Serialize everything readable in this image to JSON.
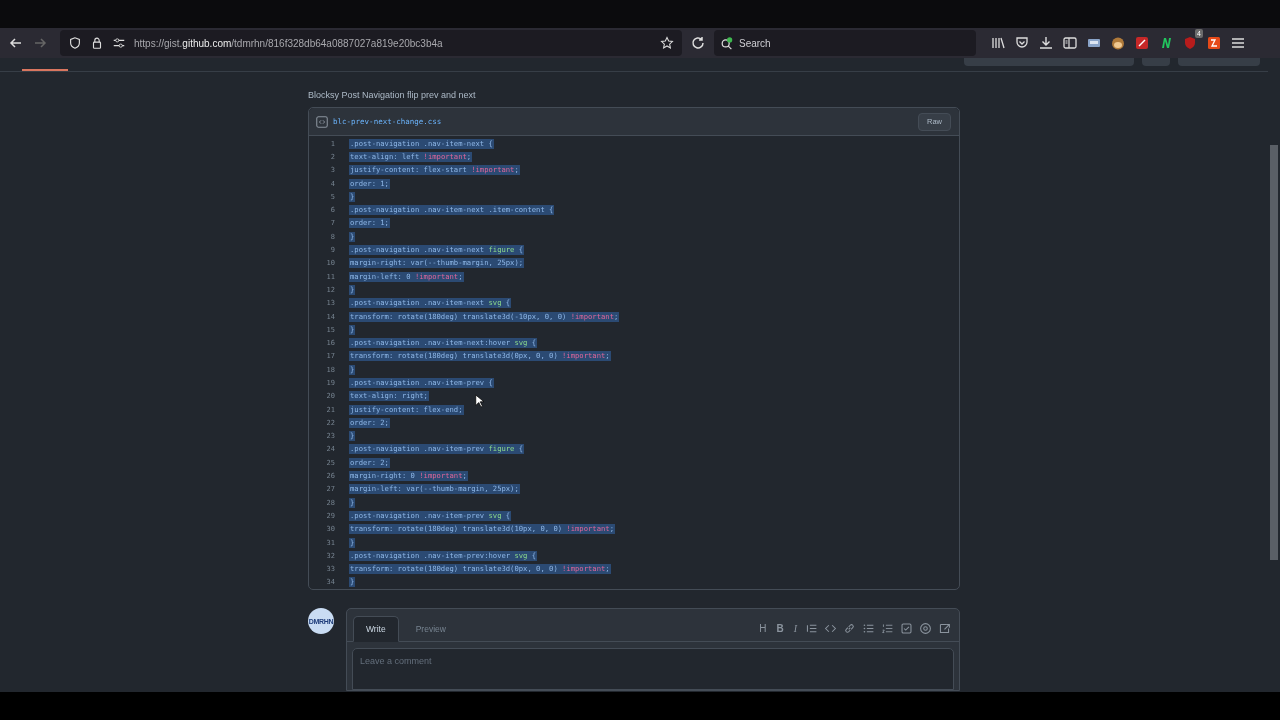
{
  "browser": {
    "url_prefix": "https://gist.",
    "url_domain": "github.com",
    "url_path": "/tdmrhn/816f328db64a0887027a819e20bc3b4a",
    "search_placeholder": "Search",
    "badge": "4"
  },
  "gist": {
    "description": "Blocksy Post Navigation flip prev and next",
    "file": {
      "name": "blc-prev-next-change.css",
      "raw_button": "Raw",
      "lines": [
        {
          "number": "1",
          "selected": true,
          "tokens": [
            {
              "text": ".post-navigation .nav-item-next {",
              "kind": "plain"
            }
          ]
        },
        {
          "number": "2",
          "selected": true,
          "tokens": [
            {
              "text": "text-align: left ",
              "kind": "plain"
            },
            {
              "text": "!important",
              "kind": "important"
            },
            {
              "text": ";",
              "kind": "plain"
            }
          ]
        },
        {
          "number": "3",
          "selected": true,
          "tokens": [
            {
              "text": "justify-content: flex-start ",
              "kind": "plain"
            },
            {
              "text": "!important",
              "kind": "important"
            },
            {
              "text": ";",
              "kind": "plain"
            }
          ]
        },
        {
          "number": "4",
          "selected": true,
          "tokens": [
            {
              "text": "order: 1;",
              "kind": "plain"
            }
          ]
        },
        {
          "number": "5",
          "selected": true,
          "tokens": [
            {
              "text": "}",
              "kind": "plain"
            }
          ]
        },
        {
          "number": "6",
          "selected": true,
          "tokens": [
            {
              "text": ".post-navigation .nav-item-next .item-content {",
              "kind": "plain"
            }
          ]
        },
        {
          "number": "7",
          "selected": true,
          "tokens": [
            {
              "text": "order: 1;",
              "kind": "plain"
            }
          ]
        },
        {
          "number": "8",
          "selected": true,
          "tokens": [
            {
              "text": "}",
              "kind": "plain"
            }
          ]
        },
        {
          "number": "9",
          "selected": true,
          "tokens": [
            {
              "text": ".post-navigation .nav-item-next ",
              "kind": "plain"
            },
            {
              "text": "figure",
              "kind": "tag"
            },
            {
              "text": " {",
              "kind": "plain"
            }
          ]
        },
        {
          "number": "10",
          "selected": true,
          "tokens": [
            {
              "text": "margin-right: var(--thumb-margin, 25px);",
              "kind": "plain"
            }
          ]
        },
        {
          "number": "11",
          "selected": true,
          "tokens": [
            {
              "text": "margin-left: 0 ",
              "kind": "plain"
            },
            {
              "text": "!important",
              "kind": "important"
            },
            {
              "text": ";",
              "kind": "plain"
            }
          ]
        },
        {
          "number": "12",
          "selected": true,
          "tokens": [
            {
              "text": "}",
              "kind": "plain"
            }
          ]
        },
        {
          "number": "13",
          "selected": true,
          "tokens": [
            {
              "text": ".post-navigation .nav-item-next ",
              "kind": "plain"
            },
            {
              "text": "svg",
              "kind": "tag"
            },
            {
              "text": " {",
              "kind": "plain"
            }
          ]
        },
        {
          "number": "14",
          "selected": true,
          "tokens": [
            {
              "text": "transform: rotate(180deg) translate3d(-10px, 0, 0) ",
              "kind": "plain"
            },
            {
              "text": "!important",
              "kind": "important"
            },
            {
              "text": ";",
              "kind": "plain"
            }
          ]
        },
        {
          "number": "15",
          "selected": true,
          "tokens": [
            {
              "text": "}",
              "kind": "plain"
            }
          ]
        },
        {
          "number": "16",
          "selected": true,
          "tokens": [
            {
              "text": ".post-navigation .nav-item-next:hover ",
              "kind": "plain"
            },
            {
              "text": "svg",
              "kind": "tag"
            },
            {
              "text": " {",
              "kind": "plain"
            }
          ]
        },
        {
          "number": "17",
          "selected": true,
          "tokens": [
            {
              "text": "transform: rotate(180deg) translate3d(0px, 0, 0) ",
              "kind": "plain"
            },
            {
              "text": "!important",
              "kind": "important"
            },
            {
              "text": ";",
              "kind": "plain"
            }
          ]
        },
        {
          "number": "18",
          "selected": true,
          "tokens": [
            {
              "text": "}",
              "kind": "plain"
            }
          ]
        },
        {
          "number": "19",
          "selected": true,
          "tokens": [
            {
              "text": ".post-navigation .nav-item-prev {",
              "kind": "plain"
            }
          ]
        },
        {
          "number": "20",
          "selected": true,
          "tokens": [
            {
              "text": "text-align: right;",
              "kind": "plain"
            }
          ]
        },
        {
          "number": "21",
          "selected": true,
          "tokens": [
            {
              "text": "justify-content: flex-end;",
              "kind": "plain"
            }
          ]
        },
        {
          "number": "22",
          "selected": true,
          "tokens": [
            {
              "text": "order: 2;",
              "kind": "plain"
            }
          ]
        },
        {
          "number": "23",
          "selected": true,
          "tokens": [
            {
              "text": "}",
              "kind": "plain"
            }
          ]
        },
        {
          "number": "24",
          "selected": true,
          "tokens": [
            {
              "text": ".post-navigation .nav-item-prev ",
              "kind": "plain"
            },
            {
              "text": "figure",
              "kind": "tag"
            },
            {
              "text": " {",
              "kind": "plain"
            }
          ]
        },
        {
          "number": "25",
          "selected": true,
          "tokens": [
            {
              "text": "order: 2;",
              "kind": "plain"
            }
          ]
        },
        {
          "number": "26",
          "selected": true,
          "tokens": [
            {
              "text": "margin-right: 0 ",
              "kind": "plain"
            },
            {
              "text": "!important",
              "kind": "important"
            },
            {
              "text": ";",
              "kind": "plain"
            }
          ]
        },
        {
          "number": "27",
          "selected": true,
          "tokens": [
            {
              "text": "margin-left: var(--thumb-margin, 25px);",
              "kind": "plain"
            }
          ]
        },
        {
          "number": "28",
          "selected": true,
          "tokens": [
            {
              "text": "}",
              "kind": "plain"
            }
          ]
        },
        {
          "number": "29",
          "selected": true,
          "tokens": [
            {
              "text": ".post-navigation .nav-item-prev ",
              "kind": "plain"
            },
            {
              "text": "svg",
              "kind": "tag"
            },
            {
              "text": " {",
              "kind": "plain"
            }
          ]
        },
        {
          "number": "30",
          "selected": true,
          "tokens": [
            {
              "text": "transform: rotate(180deg) translate3d(10px, 0, 0) ",
              "kind": "plain"
            },
            {
              "text": "!important",
              "kind": "important"
            },
            {
              "text": ";",
              "kind": "plain"
            }
          ]
        },
        {
          "number": "31",
          "selected": true,
          "tokens": [
            {
              "text": "}",
              "kind": "plain"
            }
          ]
        },
        {
          "number": "32",
          "selected": true,
          "tokens": [
            {
              "text": ".post-navigation .nav-item-prev:hover ",
              "kind": "plain"
            },
            {
              "text": "svg",
              "kind": "tag"
            },
            {
              "text": " {",
              "kind": "plain"
            }
          ]
        },
        {
          "number": "33",
          "selected": true,
          "tokens": [
            {
              "text": "transform: rotate(180deg) translate3d(0px, 0, 0) ",
              "kind": "plain"
            },
            {
              "text": "!important",
              "kind": "important"
            },
            {
              "text": ";",
              "kind": "plain"
            }
          ]
        },
        {
          "number": "34",
          "selected": true,
          "tokens": [
            {
              "text": "}",
              "kind": "plain"
            }
          ]
        }
      ]
    }
  },
  "comment": {
    "avatar_text": "DMRHN",
    "tabs": [
      {
        "label": "Write",
        "selected": true
      },
      {
        "label": "Preview",
        "selected": false
      }
    ],
    "format_letters": [
      "H",
      "B",
      "I"
    ],
    "placeholder": "Leave a comment"
  }
}
